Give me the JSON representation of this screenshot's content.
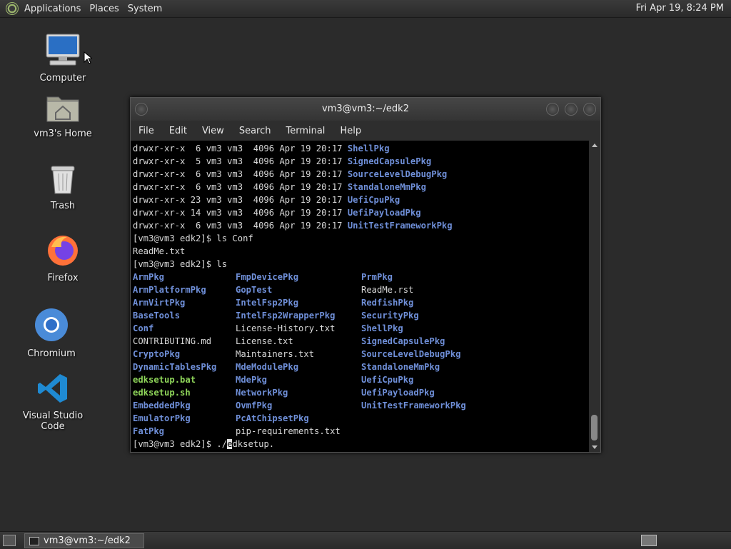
{
  "top_panel": {
    "menus": [
      "Applications",
      "Places",
      "System"
    ],
    "clock": "Fri Apr 19,  8:24 PM"
  },
  "desktop": {
    "icons": [
      {
        "label": "Computer",
        "icon": "computer-icon"
      },
      {
        "label": "vm3's Home",
        "icon": "home-folder-icon"
      },
      {
        "label": "Trash",
        "icon": "trash-icon"
      },
      {
        "label": "Firefox",
        "icon": "firefox-icon"
      },
      {
        "label": "Chromium",
        "icon": "chromium-icon"
      },
      {
        "label": "Visual Studio Code",
        "icon": "vscode-icon"
      }
    ]
  },
  "terminal": {
    "title": "vm3@vm3:~/edk2",
    "menu": [
      "File",
      "Edit",
      "View",
      "Search",
      "Terminal",
      "Help"
    ],
    "long_listing": [
      {
        "perm": "drwxr-xr-x",
        "links": " 6",
        "owner": "vm3",
        "group": "vm3",
        "size": "4096",
        "date": "Apr 19 20:17",
        "name": "ShellPkg"
      },
      {
        "perm": "drwxr-xr-x",
        "links": " 5",
        "owner": "vm3",
        "group": "vm3",
        "size": "4096",
        "date": "Apr 19 20:17",
        "name": "SignedCapsulePkg"
      },
      {
        "perm": "drwxr-xr-x",
        "links": " 6",
        "owner": "vm3",
        "group": "vm3",
        "size": "4096",
        "date": "Apr 19 20:17",
        "name": "SourceLevelDebugPkg"
      },
      {
        "perm": "drwxr-xr-x",
        "links": " 6",
        "owner": "vm3",
        "group": "vm3",
        "size": "4096",
        "date": "Apr 19 20:17",
        "name": "StandaloneMmPkg"
      },
      {
        "perm": "drwxr-xr-x",
        "links": "23",
        "owner": "vm3",
        "group": "vm3",
        "size": "4096",
        "date": "Apr 19 20:17",
        "name": "UefiCpuPkg"
      },
      {
        "perm": "drwxr-xr-x",
        "links": "14",
        "owner": "vm3",
        "group": "vm3",
        "size": "4096",
        "date": "Apr 19 20:17",
        "name": "UefiPayloadPkg"
      },
      {
        "perm": "drwxr-xr-x",
        "links": " 6",
        "owner": "vm3",
        "group": "vm3",
        "size": "4096",
        "date": "Apr 19 20:17",
        "name": "UnitTestFrameworkPkg"
      }
    ],
    "prompt": "[vm3@vm3 edk2]$ ",
    "cmd1": "ls Conf",
    "cmd1_output": "ReadMe.txt",
    "cmd2": "ls",
    "ls_grid": [
      [
        {
          "t": "ArmPkg",
          "k": "dir"
        },
        {
          "t": "FmpDevicePkg",
          "k": "dir"
        },
        {
          "t": "PrmPkg",
          "k": "dir"
        }
      ],
      [
        {
          "t": "ArmPlatformPkg",
          "k": "dir"
        },
        {
          "t": "GopTest",
          "k": "dir"
        },
        {
          "t": "ReadMe.rst",
          "k": "file"
        }
      ],
      [
        {
          "t": "ArmVirtPkg",
          "k": "dir"
        },
        {
          "t": "IntelFsp2Pkg",
          "k": "dir"
        },
        {
          "t": "RedfishPkg",
          "k": "dir"
        }
      ],
      [
        {
          "t": "BaseTools",
          "k": "dir"
        },
        {
          "t": "IntelFsp2WrapperPkg",
          "k": "dir"
        },
        {
          "t": "SecurityPkg",
          "k": "dir"
        }
      ],
      [
        {
          "t": "Conf",
          "k": "dir"
        },
        {
          "t": "License-History.txt",
          "k": "file"
        },
        {
          "t": "ShellPkg",
          "k": "dir"
        }
      ],
      [
        {
          "t": "CONTRIBUTING.md",
          "k": "file"
        },
        {
          "t": "License.txt",
          "k": "file"
        },
        {
          "t": "SignedCapsulePkg",
          "k": "dir"
        }
      ],
      [
        {
          "t": "CryptoPkg",
          "k": "dir"
        },
        {
          "t": "Maintainers.txt",
          "k": "file"
        },
        {
          "t": "SourceLevelDebugPkg",
          "k": "dir"
        }
      ],
      [
        {
          "t": "DynamicTablesPkg",
          "k": "dir"
        },
        {
          "t": "MdeModulePkg",
          "k": "dir"
        },
        {
          "t": "StandaloneMmPkg",
          "k": "dir"
        }
      ],
      [
        {
          "t": "edksetup.bat",
          "k": "exe"
        },
        {
          "t": "MdePkg",
          "k": "dir"
        },
        {
          "t": "UefiCpuPkg",
          "k": "dir"
        }
      ],
      [
        {
          "t": "edksetup.sh",
          "k": "exe"
        },
        {
          "t": "NetworkPkg",
          "k": "dir"
        },
        {
          "t": "UefiPayloadPkg",
          "k": "dir"
        }
      ],
      [
        {
          "t": "EmbeddedPkg",
          "k": "dir"
        },
        {
          "t": "OvmfPkg",
          "k": "dir"
        },
        {
          "t": "UnitTestFrameworkPkg",
          "k": "dir"
        }
      ],
      [
        {
          "t": "EmulatorPkg",
          "k": "dir"
        },
        {
          "t": "PcAtChipsetPkg",
          "k": "dir"
        },
        {
          "t": "",
          "k": "file"
        }
      ],
      [
        {
          "t": "FatPkg",
          "k": "dir"
        },
        {
          "t": "pip-requirements.txt",
          "k": "file"
        },
        {
          "t": "",
          "k": "file"
        }
      ]
    ],
    "current_input_before": "./",
    "current_input_cursor": "e",
    "current_input_after": "dksetup."
  },
  "bottom_panel": {
    "task_label": "vm3@vm3:~/edk2"
  },
  "colors": {
    "dir": "#6f8fd8",
    "exe": "#8fd65a"
  }
}
